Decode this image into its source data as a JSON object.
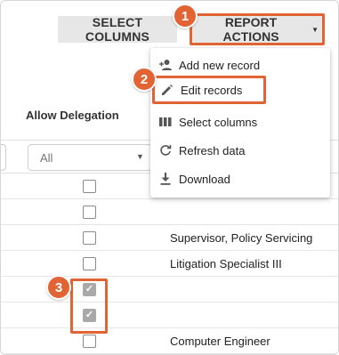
{
  "toolbar": {
    "select_columns_label": "SELECT COLUMNS",
    "report_actions_label": "REPORT ACTIONS"
  },
  "column": {
    "header": "Allow Delegation",
    "filter_value": "All"
  },
  "menu": {
    "items": [
      {
        "label": "Add new record",
        "icon": "add-person-icon"
      },
      {
        "label": "Edit records",
        "icon": "pencil-icon"
      },
      {
        "label": "Select columns",
        "icon": "columns-icon"
      },
      {
        "label": "Refresh data",
        "icon": "refresh-icon"
      },
      {
        "label": "Download",
        "icon": "download-icon"
      }
    ]
  },
  "rows": [
    {
      "allow_delegation": false,
      "text": ""
    },
    {
      "allow_delegation": false,
      "text": ""
    },
    {
      "allow_delegation": false,
      "text": "Supervisor, Policy Servicing"
    },
    {
      "allow_delegation": false,
      "text": "Litigation Specialist III"
    },
    {
      "allow_delegation": true,
      "text": ""
    },
    {
      "allow_delegation": true,
      "text": ""
    },
    {
      "allow_delegation": false,
      "text": "Computer Engineer"
    }
  ],
  "callouts": [
    "1",
    "2",
    "3"
  ],
  "colors": {
    "accent": "#e26333",
    "button_bg": "#e7e7e7",
    "checked": "#a9a9a9"
  }
}
